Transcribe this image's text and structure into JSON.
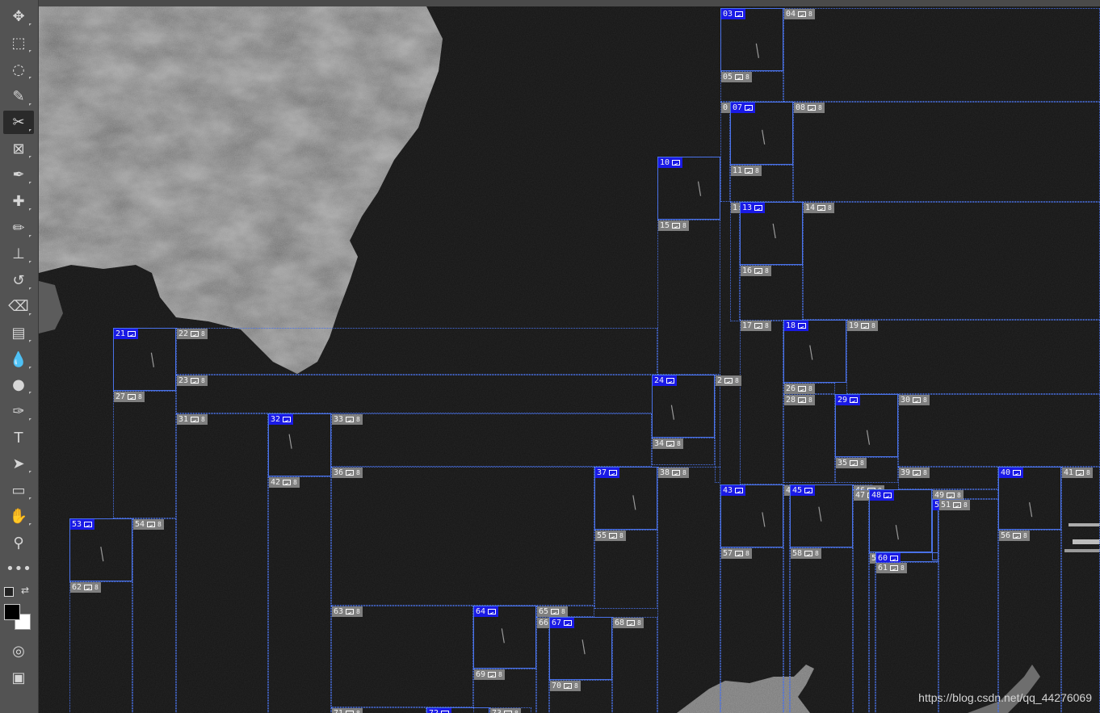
{
  "toolbar": {
    "tools": [
      {
        "name": "move-tool",
        "glyph": "✥"
      },
      {
        "name": "marquee-tool",
        "glyph": "⬚"
      },
      {
        "name": "lasso-tool",
        "glyph": "◌"
      },
      {
        "name": "quick-selection-tool",
        "glyph": "✎"
      },
      {
        "name": "slice-tool",
        "glyph": "✂"
      },
      {
        "name": "frame-tool",
        "glyph": "⊠"
      },
      {
        "name": "eyedropper-tool",
        "glyph": "✒"
      },
      {
        "name": "healing-brush-tool",
        "glyph": "✚"
      },
      {
        "name": "brush-tool",
        "glyph": "✏"
      },
      {
        "name": "clone-stamp-tool",
        "glyph": "⊥"
      },
      {
        "name": "history-brush-tool",
        "glyph": "↺"
      },
      {
        "name": "eraser-tool",
        "glyph": "⌫"
      },
      {
        "name": "gradient-tool",
        "glyph": "▤"
      },
      {
        "name": "blur-tool",
        "glyph": "💧"
      },
      {
        "name": "dodge-tool",
        "glyph": "●"
      },
      {
        "name": "pen-tool",
        "glyph": "✑"
      },
      {
        "name": "type-tool",
        "glyph": "T"
      },
      {
        "name": "path-selection-tool",
        "glyph": "➤"
      },
      {
        "name": "rectangle-tool",
        "glyph": "▭"
      },
      {
        "name": "hand-tool",
        "glyph": "✋"
      },
      {
        "name": "zoom-tool",
        "glyph": "⚲"
      },
      {
        "name": "more-tools",
        "glyph": "•••"
      }
    ],
    "foreground_color": "#000000",
    "background_color": "#ffffff",
    "quick_mask_glyph": "◎",
    "screen_mode_glyph": "▣"
  },
  "slices": [
    {
      "label": "03",
      "user": true
    },
    {
      "label": "04",
      "user": false
    },
    {
      "label": "05",
      "user": false
    },
    {
      "label": "0",
      "user": false
    },
    {
      "label": "07",
      "user": true
    },
    {
      "label": "08",
      "user": false
    },
    {
      "label": "10",
      "user": true
    },
    {
      "label": "11",
      "user": false
    },
    {
      "label": "1:",
      "user": false
    },
    {
      "label": "13",
      "user": true
    },
    {
      "label": "14",
      "user": false
    },
    {
      "label": "15",
      "user": false
    },
    {
      "label": "16",
      "user": false
    },
    {
      "label": "17",
      "user": false
    },
    {
      "label": "18",
      "user": true
    },
    {
      "label": "19",
      "user": false
    },
    {
      "label": "21",
      "user": true
    },
    {
      "label": "22",
      "user": false
    },
    {
      "label": "23",
      "user": false
    },
    {
      "label": "24",
      "user": true
    },
    {
      "label": "2",
      "user": false
    },
    {
      "label": "26",
      "user": false
    },
    {
      "label": "27",
      "user": false
    },
    {
      "label": "28",
      "user": false
    },
    {
      "label": "29",
      "user": true
    },
    {
      "label": "30",
      "user": false
    },
    {
      "label": "31",
      "user": false
    },
    {
      "label": "32",
      "user": true
    },
    {
      "label": "33",
      "user": false
    },
    {
      "label": "34",
      "user": false
    },
    {
      "label": "35",
      "user": false
    },
    {
      "label": "36",
      "user": false
    },
    {
      "label": "37",
      "user": true
    },
    {
      "label": "38",
      "user": false
    },
    {
      "label": "39",
      "user": false
    },
    {
      "label": "40",
      "user": true
    },
    {
      "label": "41",
      "user": false
    },
    {
      "label": "42",
      "user": false
    },
    {
      "label": "43",
      "user": true
    },
    {
      "label": "4",
      "user": false
    },
    {
      "label": "45",
      "user": true
    },
    {
      "label": "46",
      "user": false
    },
    {
      "label": "47",
      "user": false
    },
    {
      "label": "48",
      "user": true
    },
    {
      "label": "49",
      "user": false
    },
    {
      "label": "5",
      "user": true
    },
    {
      "label": "51",
      "user": false
    },
    {
      "label": "53",
      "user": true
    },
    {
      "label": "54",
      "user": false
    },
    {
      "label": "55",
      "user": false
    },
    {
      "label": "56",
      "user": false
    },
    {
      "label": "57",
      "user": false
    },
    {
      "label": "58",
      "user": false
    },
    {
      "label": "5",
      "user": false
    },
    {
      "label": "60",
      "user": true
    },
    {
      "label": "61",
      "user": false
    },
    {
      "label": "62",
      "user": false
    },
    {
      "label": "63",
      "user": false
    },
    {
      "label": "64",
      "user": true
    },
    {
      "label": "65",
      "user": false
    },
    {
      "label": "66",
      "user": false
    },
    {
      "label": "67",
      "user": true
    },
    {
      "label": "68",
      "user": false
    },
    {
      "label": "69",
      "user": false
    },
    {
      "label": "70",
      "user": false
    },
    {
      "label": "71",
      "user": false
    },
    {
      "label": "72",
      "user": true
    },
    {
      "label": "73",
      "user": false
    }
  ],
  "watermark": "https://blog.csdn.net/qq_44276069"
}
